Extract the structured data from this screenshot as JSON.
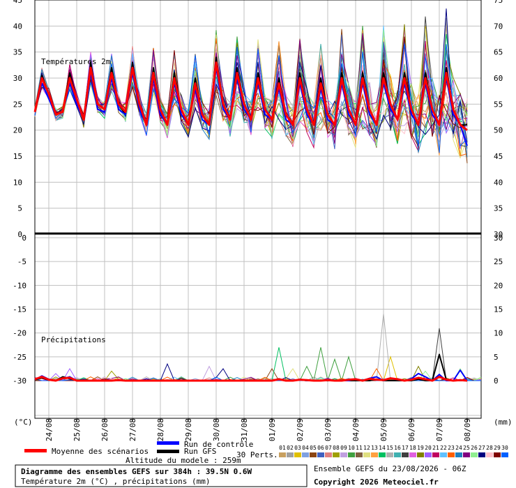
{
  "colors": {
    "mean": "#ff0000",
    "control": "#0000ff",
    "gfs": "#000000",
    "grid": "#c0c0c0"
  },
  "labels": {
    "temp_title": "Températures 2m",
    "precip_title": "Précipitations",
    "unit_left": "(°C)",
    "unit_right": "(mm)",
    "legend_mean": "Moyenne des scénarios",
    "legend_control": "Run de contrôle",
    "legend_gfs": "Run GFS",
    "legend_perts": "30 Perts.",
    "altitude": "Altitude du modele : 259m",
    "footer_title": "Diagramme des ensembles GEFS sur 384h : 39.5N 0.6W",
    "footer_sub": "Température 2m (°C) , précipitations (mm)",
    "ensemble_info": "Ensemble GEFS du 23/08/2026 - 06Z",
    "copyright": "Copyright 2026 Meteociel.fr"
  },
  "chart_data": [
    {
      "type": "line",
      "title": "Températures 2m",
      "xlabel": "",
      "ylabel": "(°C)",
      "ylim": [
        0,
        45
      ],
      "y_ticks": [
        0,
        5,
        10,
        15,
        20,
        25,
        30,
        35,
        40,
        45
      ],
      "y2_ticks": [
        30,
        35,
        40,
        45,
        50,
        55,
        60,
        65,
        70,
        75
      ],
      "x_ticks": [
        "24/08",
        "25/08",
        "26/08",
        "27/08",
        "28/08",
        "29/08",
        "30/08",
        "31/08",
        "01/09",
        "02/09",
        "03/09",
        "04/09",
        "05/09",
        "06/09",
        "07/09",
        "08/09"
      ],
      "x_hours": [
        0,
        6,
        12,
        18,
        24,
        30,
        36,
        42,
        48,
        54,
        60,
        66,
        72,
        78,
        84,
        90,
        96,
        102,
        108,
        114,
        120,
        126,
        132,
        138,
        144,
        150,
        156,
        162,
        168,
        174,
        180,
        186,
        192,
        198,
        204,
        210,
        216,
        222,
        228,
        234,
        240,
        246,
        252,
        258,
        264,
        270,
        276,
        282,
        288,
        294,
        300,
        306,
        312,
        318,
        324,
        330,
        336,
        342,
        348,
        354,
        360,
        366,
        372,
        378,
        384
      ],
      "series": [
        {
          "name": "Moyenne des scénarios",
          "values": [
            23.5,
            30,
            27,
            23,
            23.5,
            30,
            26,
            22,
            32,
            25,
            24,
            31,
            25,
            23.5,
            32,
            25,
            21,
            31,
            24,
            21,
            30,
            24,
            21,
            29,
            23,
            21,
            33,
            25,
            22,
            31,
            25,
            22,
            30,
            24,
            22,
            29,
            23,
            21,
            30,
            24,
            21,
            29,
            23,
            21,
            30,
            24,
            21,
            30,
            24,
            21,
            30,
            25,
            22,
            30,
            24,
            21,
            30,
            24,
            21,
            31,
            24,
            21,
            20
          ]
        },
        {
          "name": "Run de contrôle",
          "values": [
            23.5,
            29,
            26,
            23,
            23.5,
            29,
            25,
            22,
            31,
            24,
            23.5,
            30,
            24,
            23,
            31,
            24,
            21,
            30,
            23,
            21,
            29,
            23,
            21,
            28,
            22,
            21,
            32,
            24,
            22,
            30,
            24,
            22,
            29,
            23,
            22,
            28,
            22,
            21,
            29,
            23,
            21,
            28,
            22,
            21,
            29,
            23,
            21,
            29,
            23,
            21,
            29,
            24,
            22,
            29,
            23,
            21,
            29,
            23,
            21,
            30,
            23,
            21,
            17
          ]
        },
        {
          "name": "Run GFS",
          "values": [
            23.5,
            30.5,
            27,
            23,
            23.5,
            31,
            26,
            22,
            33,
            25,
            24,
            32,
            25,
            23,
            33,
            25,
            21,
            32,
            24,
            21,
            31,
            24,
            21,
            30,
            23,
            21,
            34,
            25,
            22,
            32,
            25,
            22,
            31,
            24,
            22,
            30,
            23,
            21,
            31,
            24,
            21,
            30,
            23,
            21,
            31,
            24,
            21,
            31,
            24,
            21,
            31,
            25,
            22,
            31,
            24,
            21,
            31,
            24,
            21,
            32,
            24,
            21,
            21
          ]
        }
      ]
    },
    {
      "type": "line",
      "title": "Précipitations",
      "xlabel": "",
      "ylabel": "(mm)",
      "ylim": [
        0,
        30
      ],
      "y_ticks": [
        0,
        5,
        10,
        15,
        20,
        25,
        30
      ],
      "y2_ticks": [
        0,
        5,
        10,
        15,
        20,
        25,
        30
      ],
      "x_ticks": [
        "24/08",
        "25/08",
        "26/08",
        "27/08",
        "28/08",
        "29/08",
        "30/08",
        "31/08",
        "01/09",
        "02/09",
        "03/09",
        "04/09",
        "05/09",
        "06/09",
        "07/09",
        "08/09"
      ],
      "x_hours": [
        0,
        6,
        12,
        18,
        24,
        30,
        36,
        42,
        48,
        54,
        60,
        66,
        72,
        78,
        84,
        90,
        96,
        102,
        108,
        114,
        120,
        126,
        132,
        138,
        144,
        150,
        156,
        162,
        168,
        174,
        180,
        186,
        192,
        198,
        204,
        210,
        216,
        222,
        228,
        234,
        240,
        246,
        252,
        258,
        264,
        270,
        276,
        282,
        288,
        294,
        300,
        306,
        312,
        318,
        324,
        330,
        336,
        342,
        348,
        354,
        360,
        366,
        372,
        378,
        384
      ],
      "series": [
        {
          "name": "Moyenne des scénarios",
          "values": [
            0.3,
            0.8,
            0.2,
            0,
            0.5,
            0.6,
            0,
            0,
            0,
            0,
            0,
            0,
            0.1,
            0,
            0,
            0,
            0,
            0,
            0,
            0,
            0,
            0,
            0,
            0,
            0,
            0,
            0,
            0,
            0,
            0,
            0,
            0,
            0,
            0,
            0,
            0.3,
            0,
            0,
            0.2,
            0.1,
            0,
            0,
            0.1,
            0,
            0,
            0.2,
            0.3,
            0,
            0.4,
            0.2,
            0.1,
            0.5,
            0.3,
            0,
            0.2,
            0.6,
            0.3,
            0,
            0.8,
            0.2,
            0,
            0.1,
            0
          ]
        },
        {
          "name": "Run de contrôle",
          "values": [
            0.2,
            1,
            0.3,
            0,
            0.4,
            0.8,
            0,
            0,
            0,
            0,
            0,
            0,
            0,
            0,
            0,
            0,
            0,
            0,
            0,
            0,
            0,
            0,
            0,
            0,
            0,
            0,
            0,
            0,
            0,
            0,
            0,
            0,
            0,
            0,
            0,
            0.2,
            0,
            0,
            0.3,
            0,
            0,
            0,
            0.2,
            0,
            0,
            0,
            0.4,
            0,
            0.5,
            0.8,
            0,
            0.5,
            0.2,
            0,
            0.4,
            1.5,
            0.8,
            0,
            1.3,
            0,
            0,
            2.2,
            0
          ]
        },
        {
          "name": "Run GFS",
          "values": [
            0.2,
            0.6,
            0.1,
            0,
            0.8,
            0.4,
            0,
            0,
            0,
            0,
            0,
            0,
            0,
            0,
            0,
            0,
            0,
            0,
            0,
            0,
            0,
            0,
            0,
            0,
            0,
            0,
            0,
            0,
            0,
            0,
            0,
            0,
            0,
            0,
            0,
            0.4,
            0,
            0,
            0.2,
            0,
            0,
            0,
            0,
            0,
            0,
            0,
            0,
            0,
            0,
            0.3,
            0,
            0,
            0,
            0,
            0,
            0.3,
            0,
            0,
            5.5,
            0.2,
            0,
            0,
            0
          ]
        }
      ]
    }
  ]
}
